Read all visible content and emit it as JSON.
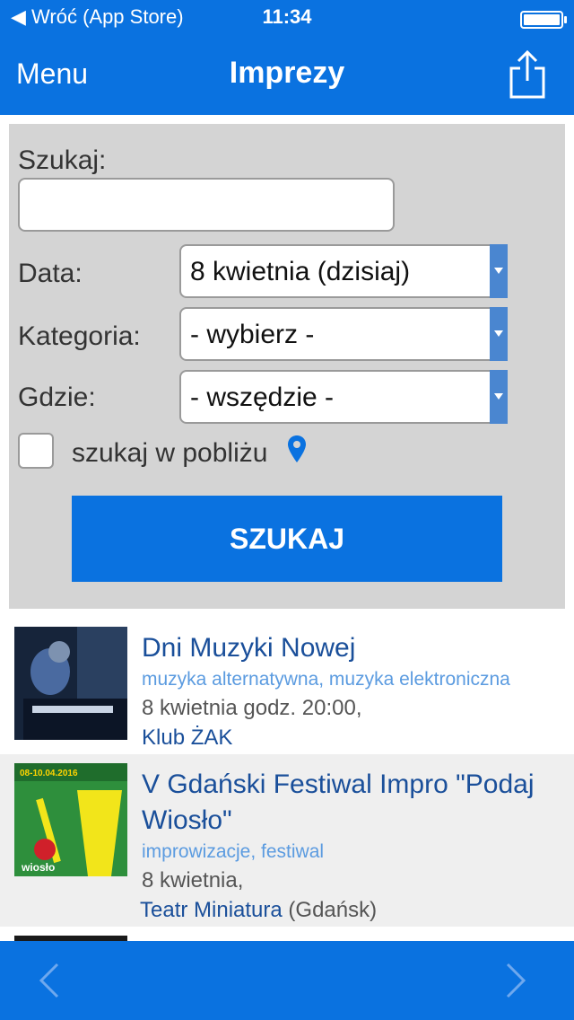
{
  "status": {
    "back": "◀ Wróć (App Store)",
    "time": "11:34"
  },
  "nav": {
    "menu": "Menu",
    "title": "Imprezy"
  },
  "search": {
    "label": "Szukaj:",
    "value": "",
    "date_label": "Data:",
    "date_value": "8 kwietnia (dzisiaj)",
    "category_label": "Kategoria:",
    "category_value": "- wybierz -",
    "where_label": "Gdzie:",
    "where_value": "- wszędzie -",
    "nearby_label": "szukaj w pobliżu",
    "nearby_checked": false,
    "button": "SZUKAJ"
  },
  "events": [
    {
      "title": "Dni Muzyki Nowej",
      "categories": "muzyka alternatywna, muzyka elektroniczna",
      "date": "8 kwietnia godz. 20:00,",
      "venue": "Klub ŻAK",
      "city": ""
    },
    {
      "title": "V Gdański Festiwal Impro \"Podaj Wiosło\"",
      "categories": "improwizacje, festiwal",
      "date": "8 kwietnia,",
      "venue": "Teatr Miniatura",
      "city": " (Gdańsk)",
      "thumb_text": "08-10.04.2016",
      "thumb_logo": "wiosło"
    }
  ],
  "colors": {
    "accent": "#0a72e0",
    "panel": "#d4d4d4",
    "link": "#1a4f9a",
    "category": "#5b9be0"
  }
}
